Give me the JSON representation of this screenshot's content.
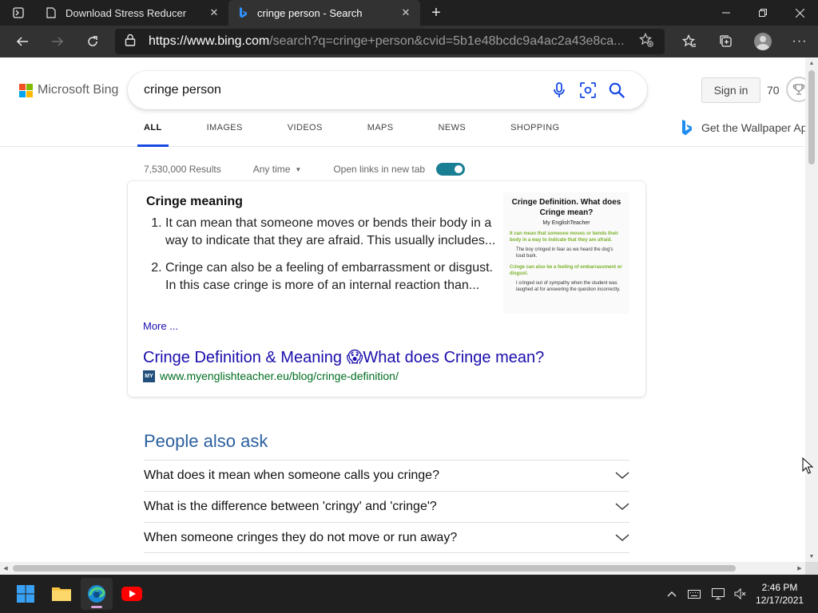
{
  "browser": {
    "tabs": [
      {
        "title": "Download Stress Reducer",
        "active": false,
        "icon": "page-icon"
      },
      {
        "title": "cringe person - Search",
        "active": true,
        "icon": "bing-icon"
      }
    ],
    "url": {
      "scheme": "https://",
      "host": "www.bing.com",
      "path": "/search?q=cringe+person&cvid=5b1e48bcdc9a4ac2a43e8ca..."
    }
  },
  "header": {
    "logo_text": "Microsoft Bing",
    "search_query": "cringe person",
    "sign_in": "Sign in",
    "points": "70",
    "wallpaper_text": "Get the Wallpaper Ap"
  },
  "scopes": [
    {
      "label": "ALL",
      "active": true
    },
    {
      "label": "IMAGES",
      "active": false
    },
    {
      "label": "VIDEOS",
      "active": false
    },
    {
      "label": "MAPS",
      "active": false
    },
    {
      "label": "NEWS",
      "active": false
    },
    {
      "label": "SHOPPING",
      "active": false
    }
  ],
  "meta": {
    "results_count": "7,530,000 Results",
    "any_time": "Any time",
    "open_links_label": "Open links in new tab",
    "open_links_on": true
  },
  "answer_card": {
    "heading": "Cringe meaning",
    "items": [
      "It can mean that someone moves or bends their body in a way to indicate that they are afraid. This usually includes...",
      "Cringe can also be a feeling of embarrassment or disgust. In this case cringe is more of an internal reaction than..."
    ],
    "more": "More ...",
    "thumbnail": {
      "title": "Cringe Definition. What does Cringe mean?",
      "brand": "My EnglishTeacher",
      "green1": "It can mean that someone moves or bends their body in a way to indicate that they are afraid.",
      "black1": "The boy cringed in fear as we heard the dog's loud bark.",
      "green2": "Cringe can also be a feeling of embarrassment or disgust.",
      "black2": "I cringed out of sympathy when the student was laughed at for answering the question incorrectly."
    },
    "result_title": "Cringe Definition & Meaning 😱What does Cringe mean?",
    "result_url": "www.myenglishteacher.eu/blog/cringe-definition/",
    "favicon_text": "MY"
  },
  "people_also_ask": {
    "heading": "People also ask",
    "questions": [
      "What does it mean when someone calls you cringe?",
      "What is the difference between 'cringy' and 'cringe'?",
      "When someone cringes they do not move or run away?"
    ]
  },
  "taskbar": {
    "time": "2:46 PM",
    "date": "12/17/2021"
  },
  "colors": {
    "link": "#1a0dab",
    "url_green": "#006d21",
    "accent_blue": "#174ae4",
    "toggle": "#1a7f94",
    "paa_heading": "#2a5f9e"
  }
}
